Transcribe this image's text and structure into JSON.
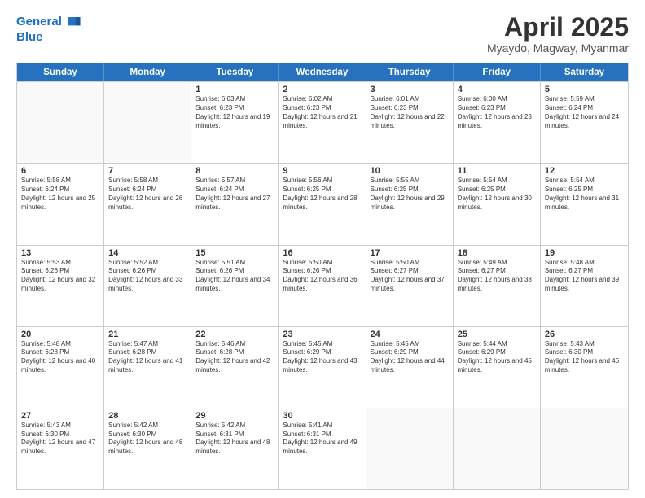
{
  "logo": {
    "text1": "General",
    "text2": "Blue"
  },
  "header": {
    "month_year": "April 2025",
    "location": "Myaydo, Magway, Myanmar"
  },
  "weekdays": [
    "Sunday",
    "Monday",
    "Tuesday",
    "Wednesday",
    "Thursday",
    "Friday",
    "Saturday"
  ],
  "rows": [
    [
      {
        "day": "",
        "sunrise": "",
        "sunset": "",
        "daylight": ""
      },
      {
        "day": "",
        "sunrise": "",
        "sunset": "",
        "daylight": ""
      },
      {
        "day": "1",
        "sunrise": "Sunrise: 6:03 AM",
        "sunset": "Sunset: 6:23 PM",
        "daylight": "Daylight: 12 hours and 19 minutes."
      },
      {
        "day": "2",
        "sunrise": "Sunrise: 6:02 AM",
        "sunset": "Sunset: 6:23 PM",
        "daylight": "Daylight: 12 hours and 21 minutes."
      },
      {
        "day": "3",
        "sunrise": "Sunrise: 6:01 AM",
        "sunset": "Sunset: 6:23 PM",
        "daylight": "Daylight: 12 hours and 22 minutes."
      },
      {
        "day": "4",
        "sunrise": "Sunrise: 6:00 AM",
        "sunset": "Sunset: 6:23 PM",
        "daylight": "Daylight: 12 hours and 23 minutes."
      },
      {
        "day": "5",
        "sunrise": "Sunrise: 5:59 AM",
        "sunset": "Sunset: 6:24 PM",
        "daylight": "Daylight: 12 hours and 24 minutes."
      }
    ],
    [
      {
        "day": "6",
        "sunrise": "Sunrise: 5:58 AM",
        "sunset": "Sunset: 6:24 PM",
        "daylight": "Daylight: 12 hours and 25 minutes."
      },
      {
        "day": "7",
        "sunrise": "Sunrise: 5:58 AM",
        "sunset": "Sunset: 6:24 PM",
        "daylight": "Daylight: 12 hours and 26 minutes."
      },
      {
        "day": "8",
        "sunrise": "Sunrise: 5:57 AM",
        "sunset": "Sunset: 6:24 PM",
        "daylight": "Daylight: 12 hours and 27 minutes."
      },
      {
        "day": "9",
        "sunrise": "Sunrise: 5:56 AM",
        "sunset": "Sunset: 6:25 PM",
        "daylight": "Daylight: 12 hours and 28 minutes."
      },
      {
        "day": "10",
        "sunrise": "Sunrise: 5:55 AM",
        "sunset": "Sunset: 6:25 PM",
        "daylight": "Daylight: 12 hours and 29 minutes."
      },
      {
        "day": "11",
        "sunrise": "Sunrise: 5:54 AM",
        "sunset": "Sunset: 6:25 PM",
        "daylight": "Daylight: 12 hours and 30 minutes."
      },
      {
        "day": "12",
        "sunrise": "Sunrise: 5:54 AM",
        "sunset": "Sunset: 6:25 PM",
        "daylight": "Daylight: 12 hours and 31 minutes."
      }
    ],
    [
      {
        "day": "13",
        "sunrise": "Sunrise: 5:53 AM",
        "sunset": "Sunset: 6:26 PM",
        "daylight": "Daylight: 12 hours and 32 minutes."
      },
      {
        "day": "14",
        "sunrise": "Sunrise: 5:52 AM",
        "sunset": "Sunset: 6:26 PM",
        "daylight": "Daylight: 12 hours and 33 minutes."
      },
      {
        "day": "15",
        "sunrise": "Sunrise: 5:51 AM",
        "sunset": "Sunset: 6:26 PM",
        "daylight": "Daylight: 12 hours and 34 minutes."
      },
      {
        "day": "16",
        "sunrise": "Sunrise: 5:50 AM",
        "sunset": "Sunset: 6:26 PM",
        "daylight": "Daylight: 12 hours and 36 minutes."
      },
      {
        "day": "17",
        "sunrise": "Sunrise: 5:50 AM",
        "sunset": "Sunset: 6:27 PM",
        "daylight": "Daylight: 12 hours and 37 minutes."
      },
      {
        "day": "18",
        "sunrise": "Sunrise: 5:49 AM",
        "sunset": "Sunset: 6:27 PM",
        "daylight": "Daylight: 12 hours and 38 minutes."
      },
      {
        "day": "19",
        "sunrise": "Sunrise: 5:48 AM",
        "sunset": "Sunset: 6:27 PM",
        "daylight": "Daylight: 12 hours and 39 minutes."
      }
    ],
    [
      {
        "day": "20",
        "sunrise": "Sunrise: 5:48 AM",
        "sunset": "Sunset: 6:28 PM",
        "daylight": "Daylight: 12 hours and 40 minutes."
      },
      {
        "day": "21",
        "sunrise": "Sunrise: 5:47 AM",
        "sunset": "Sunset: 6:28 PM",
        "daylight": "Daylight: 12 hours and 41 minutes."
      },
      {
        "day": "22",
        "sunrise": "Sunrise: 5:46 AM",
        "sunset": "Sunset: 6:28 PM",
        "daylight": "Daylight: 12 hours and 42 minutes."
      },
      {
        "day": "23",
        "sunrise": "Sunrise: 5:45 AM",
        "sunset": "Sunset: 6:29 PM",
        "daylight": "Daylight: 12 hours and 43 minutes."
      },
      {
        "day": "24",
        "sunrise": "Sunrise: 5:45 AM",
        "sunset": "Sunset: 6:29 PM",
        "daylight": "Daylight: 12 hours and 44 minutes."
      },
      {
        "day": "25",
        "sunrise": "Sunrise: 5:44 AM",
        "sunset": "Sunset: 6:29 PM",
        "daylight": "Daylight: 12 hours and 45 minutes."
      },
      {
        "day": "26",
        "sunrise": "Sunrise: 5:43 AM",
        "sunset": "Sunset: 6:30 PM",
        "daylight": "Daylight: 12 hours and 46 minutes."
      }
    ],
    [
      {
        "day": "27",
        "sunrise": "Sunrise: 5:43 AM",
        "sunset": "Sunset: 6:30 PM",
        "daylight": "Daylight: 12 hours and 47 minutes."
      },
      {
        "day": "28",
        "sunrise": "Sunrise: 5:42 AM",
        "sunset": "Sunset: 6:30 PM",
        "daylight": "Daylight: 12 hours and 48 minutes."
      },
      {
        "day": "29",
        "sunrise": "Sunrise: 5:42 AM",
        "sunset": "Sunset: 6:31 PM",
        "daylight": "Daylight: 12 hours and 48 minutes."
      },
      {
        "day": "30",
        "sunrise": "Sunrise: 5:41 AM",
        "sunset": "Sunset: 6:31 PM",
        "daylight": "Daylight: 12 hours and 49 minutes."
      },
      {
        "day": "",
        "sunrise": "",
        "sunset": "",
        "daylight": ""
      },
      {
        "day": "",
        "sunrise": "",
        "sunset": "",
        "daylight": ""
      },
      {
        "day": "",
        "sunrise": "",
        "sunset": "",
        "daylight": ""
      }
    ]
  ]
}
